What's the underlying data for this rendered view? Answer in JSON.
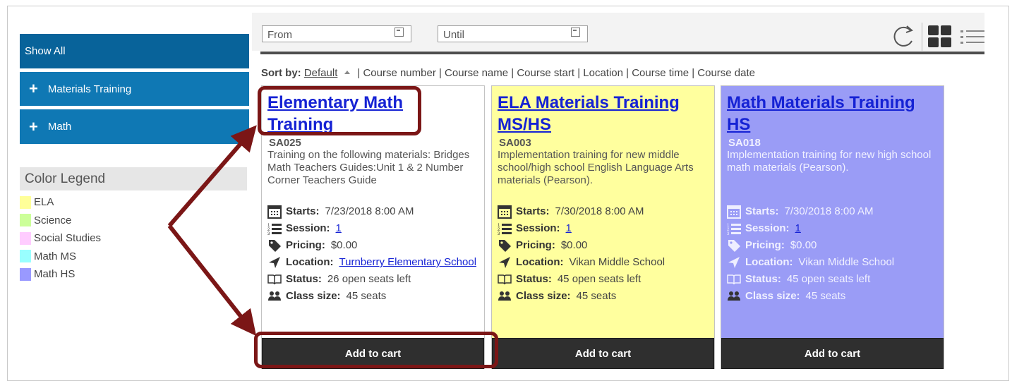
{
  "sidebar": {
    "show_all": "Show All",
    "items": [
      {
        "label": "Materials Training",
        "icon": "plus-icon"
      },
      {
        "label": "Math",
        "icon": "plus-icon"
      }
    ],
    "legend_title": "Color Legend",
    "legend": [
      {
        "label": "ELA",
        "color": "#ffff99"
      },
      {
        "label": "Science",
        "color": "#ccff99"
      },
      {
        "label": "Social Studies",
        "color": "#ffccff"
      },
      {
        "label": "Math MS",
        "color": "#99ffff"
      },
      {
        "label": "Math HS",
        "color": "#9999ff"
      }
    ]
  },
  "toolbar": {
    "from_placeholder": "From",
    "until_placeholder": "Until",
    "icons": [
      "calendar-icon",
      "refresh-icon",
      "grid-view-icon",
      "list-view-icon"
    ]
  },
  "sort": {
    "label": "Sort by:",
    "default": "Default",
    "options": "| Course number | Course name | Course start | Location | Course time | Course date"
  },
  "cards": [
    {
      "title_line1": "Elementary Math",
      "title_line2": "Training",
      "code": "SA025",
      "description": "Training on the following materials: Bridges Math Teachers Guides:Unit 1 & 2 Number Corner Teachers Guide",
      "starts_label": "Starts:",
      "starts": "7/23/2018 8:00 AM",
      "session_label": "Session:",
      "session": "1",
      "pricing_label": "Pricing:",
      "pricing": "$0.00",
      "location_label": "Location:",
      "location": "Turnberry Elementary School",
      "status_label": "Status:",
      "status": "26 open seats left",
      "class_size_label": "Class size:",
      "class_size": "45 seats",
      "button": "Add to cart",
      "color": "#ffffff"
    },
    {
      "title_line1": "ELA Materials Training",
      "title_line2": "MS/HS",
      "code": "SA003",
      "description": "Implementation training for new middle school/high school English Language Arts materials (Pearson).",
      "starts_label": "Starts:",
      "starts": "7/30/2018 8:00 AM",
      "session_label": "Session:",
      "session": "1",
      "pricing_label": "Pricing:",
      "pricing": "$0.00",
      "location_label": "Location:",
      "location": "Vikan Middle School",
      "status_label": "Status:",
      "status": "45 open seats left",
      "class_size_label": "Class size:",
      "class_size": "45 seats",
      "button": "Add to cart",
      "color": "#ffff9e"
    },
    {
      "title_line1": "Math Materials Training",
      "title_line2": "HS",
      "code": "SA018",
      "description": "Implementation training for new high school math materials (Pearson).",
      "starts_label": "Starts:",
      "starts": "7/30/2018 8:00 AM",
      "session_label": "Session:",
      "session": "1",
      "pricing_label": "Pricing:",
      "pricing": "$0.00",
      "location_label": "Location:",
      "location": "Vikan Middle School",
      "status_label": "Status:",
      "status": "45 open seats left",
      "class_size_label": "Class size:",
      "class_size": "45 seats",
      "button": "Add to cart",
      "color": "#9a9cf6"
    }
  ],
  "annotation_color": "#7b1616"
}
